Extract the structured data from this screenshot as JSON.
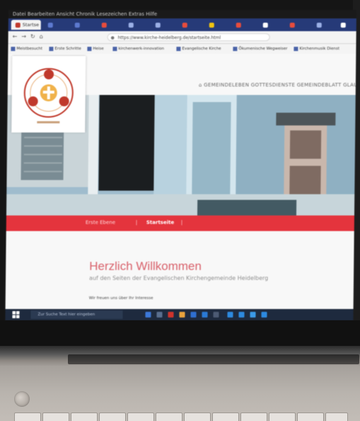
{
  "browser": {
    "title_bar": "Datei  Bearbeiten  Ansicht  Chronik  Lesezeichen  Extras  Hilfe",
    "active_tab": "Startse",
    "address_url": "https://www.kirche-heidelberg.de/startseite.html",
    "bookmarks": [
      "Meistbesucht",
      "Erste Schritte",
      "Heise",
      "kirchenwerk-innovation",
      "Evangelische Kirche",
      "Ökumenische Wegweiser",
      "Kirchenmusik Dienst"
    ]
  },
  "site": {
    "nav": "GEMEINDELEBEN   GOTTESDIENSTE   GEMEINDEBLATT   GLAUBE",
    "breadcrumb_home": "Erste Ebene",
    "breadcrumb_current": "Startseite",
    "welcome_title": "Herzlich Willkommen",
    "welcome_subtitle": "auf den Seiten der Evangelischen Kirchengemeinde Heidelberg",
    "intro_text": "Wir freuen uns über Ihr Interesse"
  },
  "taskbar": {
    "search_placeholder": "Zur Suche Text hier eingeben"
  },
  "colors": {
    "accent_red": "#e4343d",
    "taskbar": "#1e2a3e",
    "tab_strip": "#263a78"
  }
}
